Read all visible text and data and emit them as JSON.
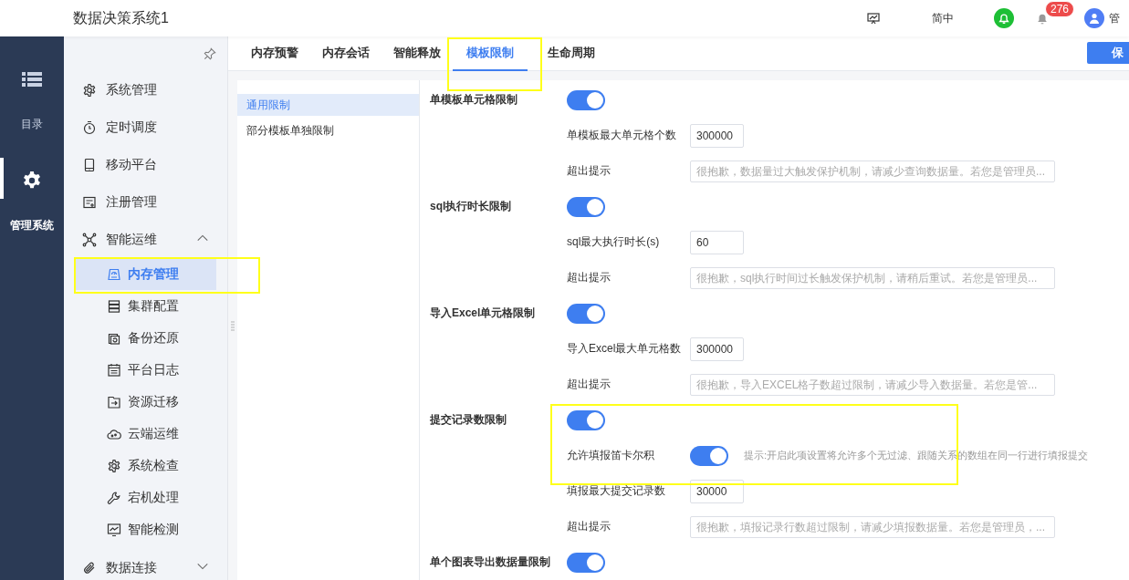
{
  "app": {
    "title": "数据决策系统1"
  },
  "header": {
    "language": "简中",
    "notification_count": "276",
    "user": "管"
  },
  "rail": [
    {
      "label": "目录",
      "selected": false
    },
    {
      "label": "管理系统",
      "selected": true
    }
  ],
  "nav": [
    {
      "label": "系统管理",
      "selected": false
    },
    {
      "label": "定时调度",
      "selected": false
    },
    {
      "label": "移动平台",
      "selected": false
    },
    {
      "label": "注册管理",
      "selected": false
    },
    {
      "label": "智能运维",
      "selected": false,
      "expanded": true,
      "children": [
        {
          "label": "内存管理",
          "selected": true
        },
        {
          "label": "集群配置",
          "selected": false
        },
        {
          "label": "备份还原",
          "selected": false
        },
        {
          "label": "平台日志",
          "selected": false
        },
        {
          "label": "资源迁移",
          "selected": false
        },
        {
          "label": "云端运维",
          "selected": false
        },
        {
          "label": "系统检查",
          "selected": false
        },
        {
          "label": "宕机处理",
          "selected": false
        },
        {
          "label": "智能检测",
          "selected": false
        }
      ]
    },
    {
      "label": "数据连接",
      "selected": false,
      "expanded": false
    }
  ],
  "tabs": [
    {
      "label": "内存预警",
      "selected": false
    },
    {
      "label": "内存会话",
      "selected": false
    },
    {
      "label": "智能释放",
      "selected": false
    },
    {
      "label": "模板限制",
      "selected": true
    },
    {
      "label": "生命周期",
      "selected": false
    }
  ],
  "save_button": "保",
  "subnav": [
    {
      "label": "通用限制",
      "selected": true
    },
    {
      "label": "部分模板单独限制",
      "selected": false
    }
  ],
  "sections": [
    {
      "title": "单模板单元格限制",
      "on": true,
      "rows": [
        {
          "kind": "number",
          "label": "单模板最大单元格个数",
          "value": "300000"
        },
        {
          "kind": "message",
          "label": "超出提示",
          "placeholder": "很抱歉，数据量过大触发保护机制，请减少查询数据量。若您是管理员..."
        }
      ]
    },
    {
      "title": "sql执行时长限制",
      "on": true,
      "rows": [
        {
          "kind": "number",
          "label": "sql最大执行时长(s)",
          "value": "60"
        },
        {
          "kind": "message",
          "label": "超出提示",
          "placeholder": "很抱歉，sql执行时间过长触发保护机制，请稍后重试。若您是管理员..."
        }
      ]
    },
    {
      "title": "导入Excel单元格限制",
      "on": true,
      "rows": [
        {
          "kind": "number",
          "label": "导入Excel最大单元格数",
          "value": "300000"
        },
        {
          "kind": "message",
          "label": "超出提示",
          "placeholder": "很抱歉，导入EXCEL格子数超过限制，请减少导入数据量。若您是管..."
        }
      ]
    },
    {
      "title": "提交记录数限制",
      "on": true,
      "rows": [
        {
          "kind": "toggle",
          "label": "允许填报笛卡尔积",
          "on": true,
          "hint": "提示:开启此项设置将允许多个无过滤、跟随关系的数组在同一行进行填报提交"
        },
        {
          "kind": "number",
          "label": "填报最大提交记录数",
          "value": "30000"
        },
        {
          "kind": "message",
          "label": "超出提示",
          "placeholder": "很抱歉，填报记录行数超过限制，请减少填报数据量。若您是管理员，..."
        }
      ]
    },
    {
      "title": "单个图表导出数据量限制",
      "on": true
    }
  ]
}
